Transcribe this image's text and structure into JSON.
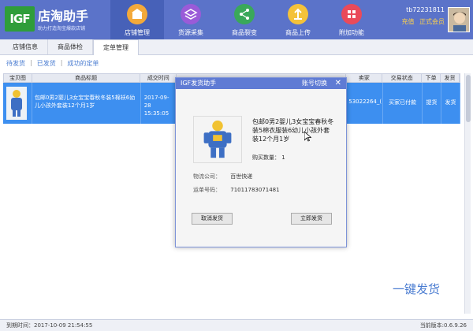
{
  "header": {
    "logo_mark": "IGF",
    "logo_title": "店淘助手",
    "logo_subtitle": "助力打造淘宝爆款店铺",
    "nav": [
      {
        "label": "店铺管理",
        "icon": "store-icon",
        "color": "#f3a93a"
      },
      {
        "label": "货源采集",
        "icon": "layers-icon",
        "color": "#9a5bd8"
      },
      {
        "label": "商品裂变",
        "icon": "share-icon",
        "color": "#3aa85a"
      },
      {
        "label": "商品上传",
        "icon": "upload-icon",
        "color": "#f4c23a"
      },
      {
        "label": "附加功能",
        "icon": "grid-icon",
        "color": "#ea4a5a"
      }
    ],
    "user_name": "tb72231811",
    "recharge": "充值",
    "member": "正式会员"
  },
  "subtabs": [
    "店铺信息",
    "商品体检",
    "定单管理"
  ],
  "filters": [
    "待发货",
    "已发货",
    "成功的定单"
  ],
  "table": {
    "headers": [
      "宝贝图",
      "商品标题",
      "成交时间",
      "卖家",
      "交易状态",
      "下单",
      "发货"
    ],
    "rows": [
      {
        "title": "包邮0男2婴儿3女宝宝春秋冬装5棉袄6幼儿小孩外套装12个月1岁",
        "time_date": "2017-09-28",
        "time_clock": "15:35:05",
        "buyer": "53022264_(",
        "status": "买家已付款",
        "order_action": "提货",
        "ship_action": "发货"
      }
    ]
  },
  "dialog": {
    "title": "IGF发货助手",
    "switch_account": "账号切换",
    "close": "✕",
    "product_name": "包邮0男2婴儿3女宝宝春秋冬装5棉衣服装6幼儿小孩外套装12个月1岁",
    "qty_label": "购买数量：",
    "qty_value": "1",
    "logistics_label": "物流公司：",
    "logistics_value": "百世快递",
    "tracking_label": "运单号码：",
    "tracking_value": "71011783071481",
    "cancel_button": "取消发货",
    "ship_button": "立即发货"
  },
  "big_label": "一键发货",
  "statusbar": {
    "left": "到期时间：2017-10-09 21:54:55",
    "right": "当前版本:0.6.9.26"
  }
}
